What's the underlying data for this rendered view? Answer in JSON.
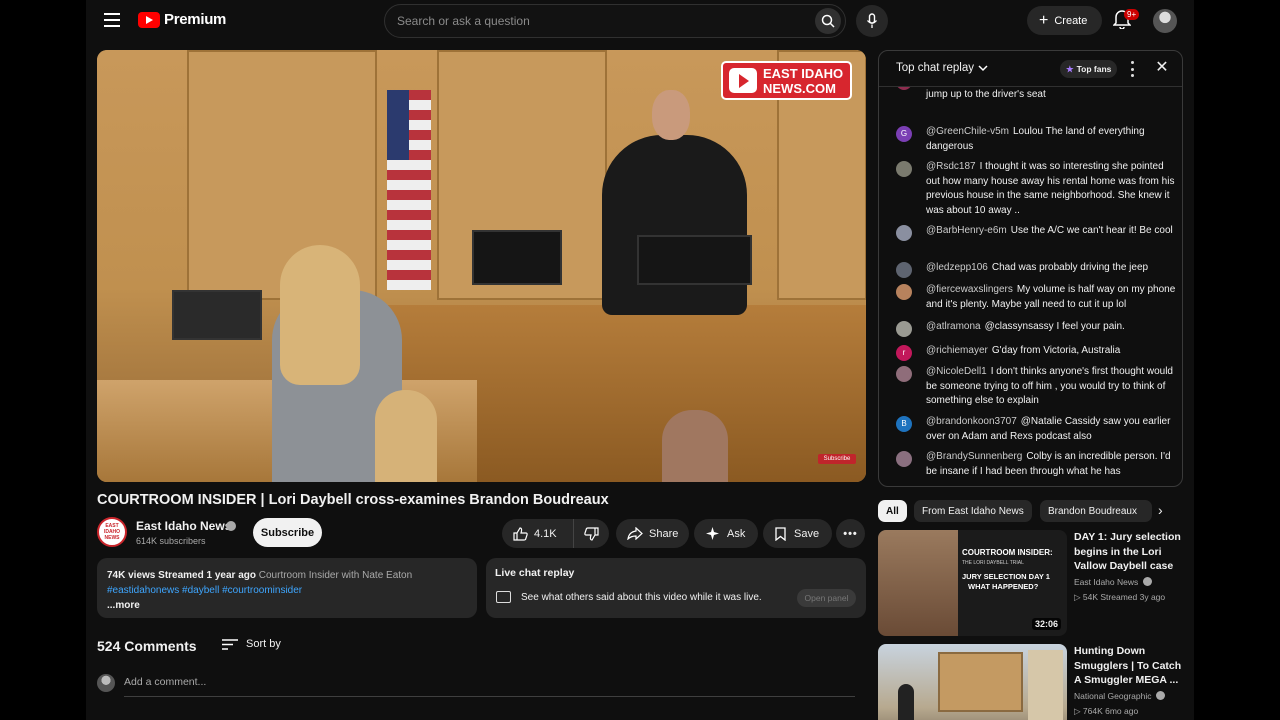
{
  "header": {
    "logo_text": "Premium",
    "search_placeholder": "Search or ask a question",
    "create_label": "Create",
    "notification_count": "9+"
  },
  "video": {
    "overlay_logo": "EAST IDAHO NEWS.COM",
    "overlay_logo_line1": "EAST IDAHO",
    "overlay_logo_line2": "NEWS.COM",
    "overlay_subscribe": "Subscribe",
    "title": "COURTROOM INSIDER | Lori Daybell cross-examines Brandon Boudreaux"
  },
  "channel": {
    "name": "East Idaho News",
    "subscribers": "614K subscribers",
    "avatar_text": "EAST IDAHO NEWS",
    "subscribe_label": "Subscribe"
  },
  "actions": {
    "like_count": "4.1K",
    "share_label": "Share",
    "ask_label": "Ask",
    "save_label": "Save"
  },
  "description": {
    "stats": "74K views  Streamed 1 year ago",
    "show": "Courtroom Insider with Nate Eaton",
    "tags": "#eastidahonews #daybell #courtroominsider",
    "more": "...more"
  },
  "live_chat_box": {
    "title": "Live chat replay",
    "text": "See what others said about this video while it was live.",
    "button": "Open panel"
  },
  "comments": {
    "count": "524 Comments",
    "sort_label": "Sort by",
    "add_placeholder": "Add a comment..."
  },
  "chat": {
    "title": "Top chat replay",
    "top_fans_label": "Top fans",
    "messages": [
      {
        "author": "",
        "text": "possible Alex was alone and had space and time to jump up to the driver's seat",
        "avatar_color": "#8e2d4f",
        "avatar_letter": ""
      },
      {
        "author": "@GreenChile-v5m",
        "text": "Loulou The land of everything dangerous",
        "avatar_color": "#7b3fb4",
        "avatar_letter": "G"
      },
      {
        "author": "@Rsdc187",
        "text": "I thought it was so interesting she pointed out how many house away his rental home was from his previous house in the same neighborhood. She knew it was about 10 away ..",
        "avatar_color": "#7a7a6e",
        "avatar_letter": ""
      },
      {
        "author": "@BarbHenry-e6m",
        "text": "Use the A/C we can't hear it! Be cool",
        "avatar_color": "#8a8fa0",
        "avatar_letter": ""
      },
      {
        "author": "@ledzepp106",
        "text": "Chad was probably driving the jeep",
        "avatar_color": "#5e6470",
        "avatar_letter": ""
      },
      {
        "author": "@fiercewaxslingers",
        "text": "My volume is half way on my phone and it's plenty. Maybe yall need to cut it up lol",
        "avatar_color": "#b7825d",
        "avatar_letter": ""
      },
      {
        "author": "@atlramona",
        "text": "@classynsassy I feel your pain.",
        "avatar_color": "#9a9a92",
        "avatar_letter": ""
      },
      {
        "author": "@richiemayer",
        "text": "G'day from Victoria, Australia",
        "avatar_color": "#c2185b",
        "avatar_letter": "r"
      },
      {
        "author": "@NicoleDell1",
        "text": "I don't thinks anyone's first thought would be someone trying to off him , you would try to think of something else to explain",
        "avatar_color": "#8f6d7a",
        "avatar_letter": ""
      },
      {
        "author": "@brandonkoon3707",
        "text": "@Natalie Cassidy saw you earlier over on Adam and Rexs podcast also",
        "avatar_color": "#1e73be",
        "avatar_letter": "B"
      },
      {
        "author": "@BrandySunnenberg",
        "text": "Colby is an incredible person. I'd be insane if I had been through what he has",
        "avatar_color": "#8a6f7f",
        "avatar_letter": ""
      }
    ]
  },
  "chips": [
    "All",
    "From East Idaho News",
    "Brandon Boudreaux"
  ],
  "recommendations": [
    {
      "title": "DAY 1: Jury selection begins in the Lori Vallow Daybell case",
      "channel": "East Idaho News",
      "stats": "54K  Streamed 3y ago",
      "duration": "32:06",
      "thumb_heading": "COURTROOM INSIDER:",
      "thumb_subheading": "THE LORI DAYBELL TRIAL",
      "thumb_line1": "JURY SELECTION DAY 1",
      "thumb_line2": "WHAT HAPPENED?"
    },
    {
      "title": "Hunting Down Smugglers | To Catch A Smuggler MEGA ...",
      "channel": "National Geographic",
      "stats": "764K  6mo ago",
      "duration": ""
    }
  ],
  "colors": {
    "background": "#0f0f0f",
    "surface": "#272727",
    "brand_red": "#ff0000",
    "link_blue": "#3ea6ff"
  }
}
